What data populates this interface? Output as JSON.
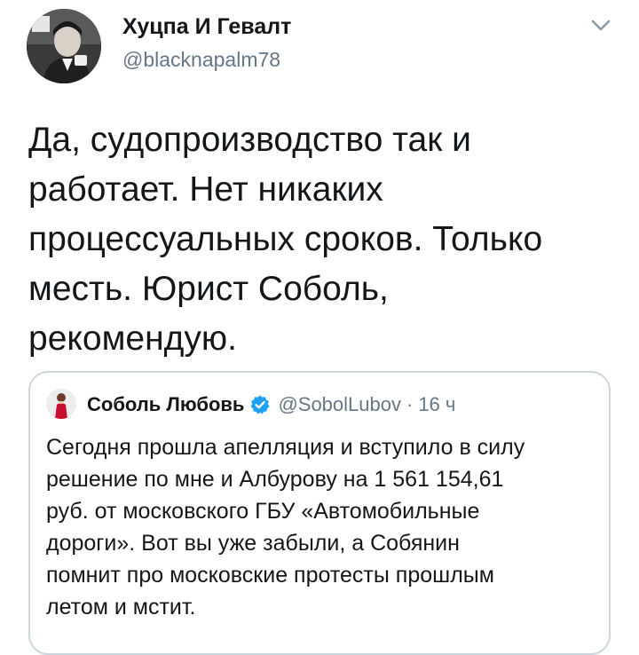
{
  "tweet": {
    "author_name": "Хуцпа И Гевалт",
    "author_handle": "@blacknapalm78",
    "text": "Да, судопроизводство так и\nработает. Нет никаких\nпроцессуальных сроков. Только\nместь. Юрист Соболь,\nрекомендую.",
    "menu_icon": "chevron-down-icon"
  },
  "quoted_tweet": {
    "author_name": "Соболь Любовь",
    "author_handle": "@SobolLubov",
    "separator": "·",
    "time": "16 ч",
    "verified_icon": "verified-badge-icon",
    "text": "Сегодня прошла апелляция и вступило в силу\nрешение по мне и Албурову на 1 561 154,61\nруб. от московского ГБУ «Автомобильные\nдороги». Вот вы уже забыли, а Собянин\nпомнит про московские протесты прошлым\nлетом и мстит."
  },
  "colors": {
    "text": "#14171a",
    "secondary": "#657786",
    "border": "#ccd6dd",
    "verified": "#1da1f2"
  }
}
